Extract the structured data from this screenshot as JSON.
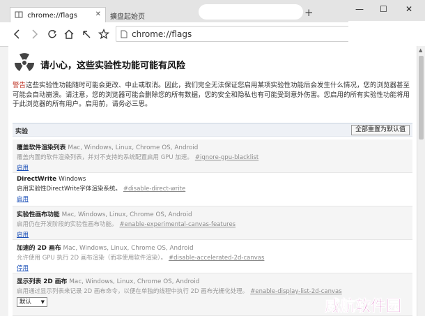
{
  "tabs": [
    {
      "title": "chrome://flags",
      "close": "✕",
      "active": true
    },
    {
      "title": "擴盘起始页",
      "active": false
    }
  ],
  "new_tab": "+",
  "window_controls": {
    "minimize": "—",
    "maximize": "☐",
    "close": "✕"
  },
  "omnibox": {
    "url": "chrome://flags"
  },
  "warning": {
    "title": "请小心，这些实验性功能可能有风险",
    "tag": "警告",
    "body": "这些实验性功能随时可能会更改、中止或取消。因此，我们完全无法保证您启用某项实验性功能后会发生什么情况，您的浏览器甚至可能会自动崩溃。请注意，您的浏览器可能会删除您的所有数据，您的安全和隐私也有可能受到意外伤害。您启用的所有实验性功能将用于此浏览器的所有用户。启用前，请务必三思。"
  },
  "section": {
    "label": "实验",
    "reset_button": "全部重置为默认值"
  },
  "experiments": [
    {
      "title": "覆盖软件渲染列表",
      "platforms": "Mac, Windows, Linux, Chrome OS, Android",
      "description": "覆盖内置的软件渲染列表，并对不支持的系统配置启用 GPU 加速。",
      "flag": "#ignore-gpu-blacklist",
      "action": "启用"
    },
    {
      "title": "DirectWrite",
      "platforms": "Windows",
      "description": "启用实验性DirectWrite字体渲染系统。",
      "flag": "#disable-direct-write",
      "action": "启用"
    },
    {
      "title": "实验性画布功能",
      "platforms": "Mac, Windows, Linux, Chrome OS, Android",
      "description": "启用仍在开发阶段的实验性画布功能。",
      "flag": "#enable-experimental-canvas-features",
      "action": "启用"
    },
    {
      "title": "加速的 2D 画布",
      "platforms": "Mac, Windows, Linux, Chrome OS, Android",
      "description": "允许使用 GPU 执行 2D 画布渲染（而非使用软件渲染）。",
      "flag": "#disable-accelerated-2d-canvas",
      "action": "停用"
    },
    {
      "title": "显示列表 2D 画布",
      "platforms": "Mac, Windows, Linux, Chrome OS, Android",
      "description": "启用通过显示列表来记录 2D 画布命令，以便在单独的线程中执行 2D 画布光栅化处理。",
      "flag": "#enable-display-list-2d-canvas",
      "select": "默认"
    }
  ],
  "watermark": "威航软件园"
}
